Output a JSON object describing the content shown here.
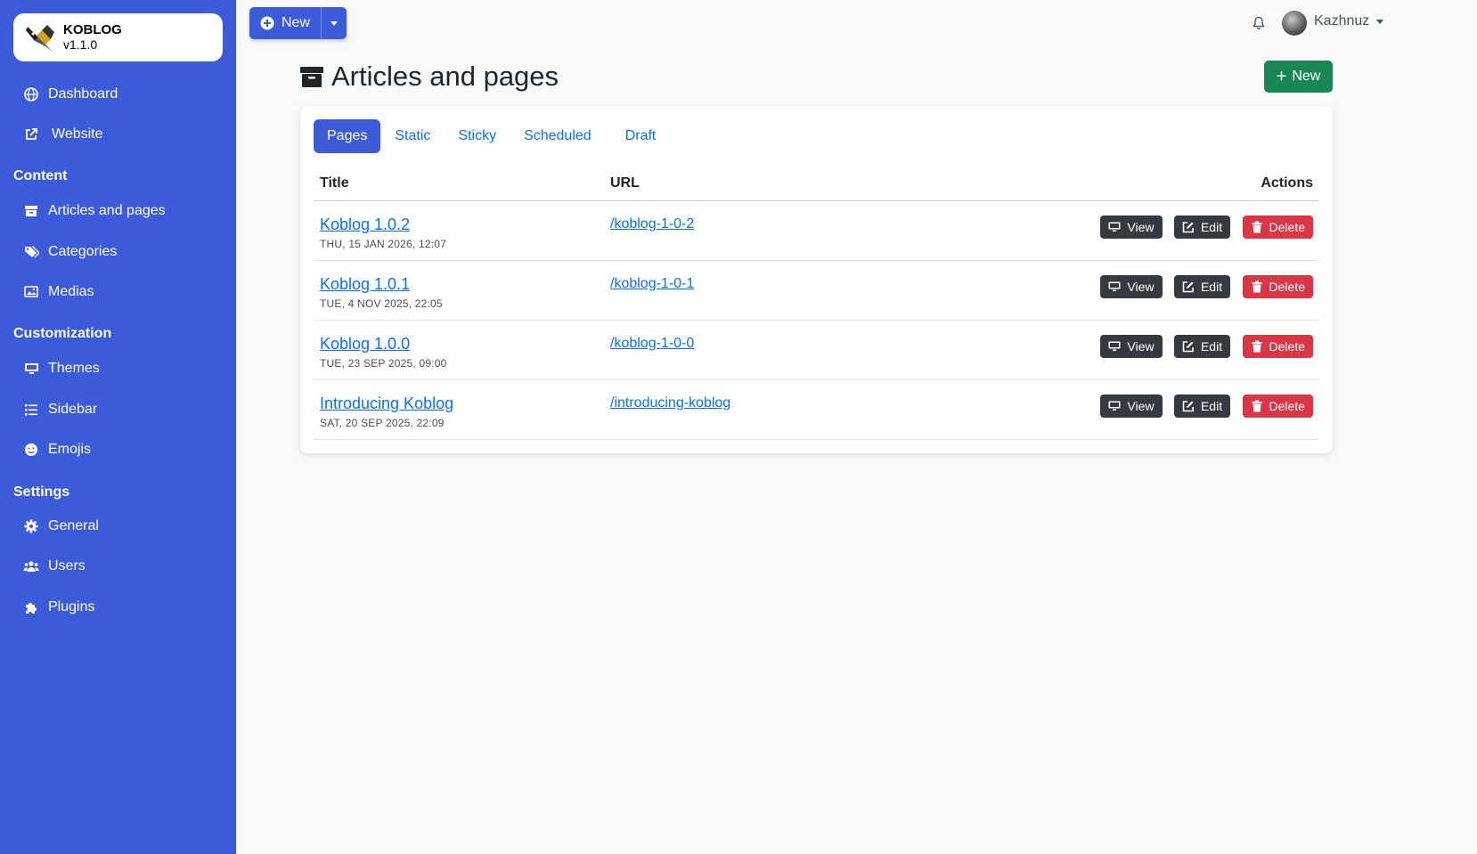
{
  "brand": {
    "name": "KOBLOG",
    "version": "v1.1.0"
  },
  "sidebar": {
    "top_items": [
      {
        "label": "Dashboard",
        "icon": "globe-icon"
      },
      {
        "label": "Website",
        "icon": "external-link-icon"
      }
    ],
    "sections": [
      {
        "title": "Content",
        "items": [
          {
            "label": "Articles and pages",
            "icon": "archive-icon"
          },
          {
            "label": "Categories",
            "icon": "tags-icon"
          },
          {
            "label": "Medias",
            "icon": "images-icon"
          }
        ]
      },
      {
        "title": "Customization",
        "items": [
          {
            "label": "Themes",
            "icon": "monitor-icon"
          },
          {
            "label": "Sidebar",
            "icon": "list-icon"
          },
          {
            "label": "Emojis",
            "icon": "smile-icon"
          }
        ]
      },
      {
        "title": "Settings",
        "items": [
          {
            "label": "General",
            "icon": "gear-icon"
          },
          {
            "label": "Users",
            "icon": "users-icon"
          },
          {
            "label": "Plugins",
            "icon": "puzzle-icon"
          }
        ]
      }
    ]
  },
  "topbar": {
    "new_label": "New",
    "username": "Kazhnuz"
  },
  "header": {
    "title": "Articles and pages",
    "new_label": "New"
  },
  "tabs": [
    {
      "label": "Pages",
      "active": true
    },
    {
      "label": "Static",
      "active": false
    },
    {
      "label": "Sticky",
      "active": false
    },
    {
      "label": "Scheduled",
      "active": false
    },
    {
      "label": "Draft",
      "active": false
    }
  ],
  "table": {
    "columns": {
      "title": "Title",
      "url": "URL",
      "actions": "Actions"
    },
    "rows": [
      {
        "title": "Koblog 1.0.2",
        "date": "THU, 15 JAN 2026, 12:07",
        "url": "/koblog-1-0-2"
      },
      {
        "title": "Koblog 1.0.1",
        "date": "TUE, 4 NOV 2025, 22:05",
        "url": "/koblog-1-0-1"
      },
      {
        "title": "Koblog 1.0.0",
        "date": "TUE, 23 SEP 2025, 09:00",
        "url": "/koblog-1-0-0"
      },
      {
        "title": "Introducing Koblog",
        "date": "SAT, 20 SEP 2025, 22:09",
        "url": "/introducing-koblog"
      }
    ],
    "action_labels": {
      "view": "View",
      "edit": "Edit",
      "delete": "Delete"
    }
  },
  "colors": {
    "sidebar": "#3b5bdb",
    "link": "#0d6efd",
    "success": "#198754",
    "danger": "#dc3545",
    "dark": "#343a40"
  }
}
